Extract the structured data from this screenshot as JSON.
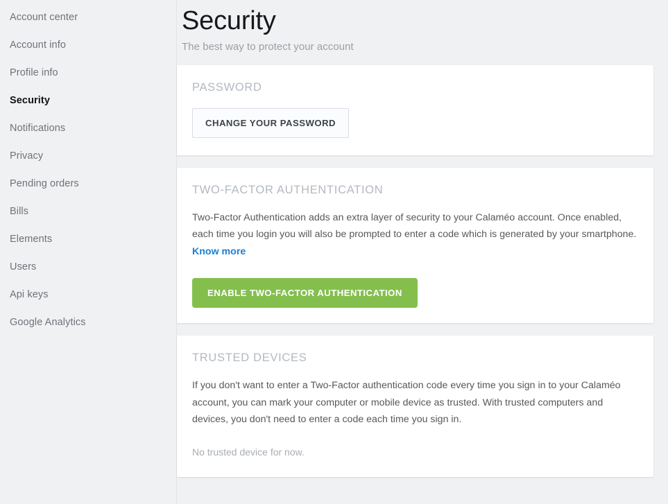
{
  "sidebar": {
    "items": [
      {
        "label": "Account center",
        "active": false
      },
      {
        "label": "Account info",
        "active": false
      },
      {
        "label": "Profile info",
        "active": false
      },
      {
        "label": "Security",
        "active": true
      },
      {
        "label": "Notifications",
        "active": false
      },
      {
        "label": "Privacy",
        "active": false
      },
      {
        "label": "Pending orders",
        "active": false
      },
      {
        "label": "Bills",
        "active": false
      },
      {
        "label": "Elements",
        "active": false
      },
      {
        "label": "Users",
        "active": false
      },
      {
        "label": "Api keys",
        "active": false
      },
      {
        "label": "Google Analytics",
        "active": false
      }
    ]
  },
  "header": {
    "title": "Security",
    "subtitle": "The best way to protect your account"
  },
  "cards": {
    "password": {
      "title": "PASSWORD",
      "button_label": "CHANGE YOUR PASSWORD"
    },
    "two_factor": {
      "title": "TWO-FACTOR AUTHENTICATION",
      "body": "Two-Factor Authentication adds an extra layer of security to your Calaméo account. Once enabled, each time you login you will also be prompted to enter a code which is generated by your smartphone.",
      "link_label": "Know more",
      "button_label": "ENABLE TWO-FACTOR AUTHENTICATION"
    },
    "trusted_devices": {
      "title": "TRUSTED DEVICES",
      "body": "If you don't want to enter a Two-Factor authentication code every time you sign in to your Calaméo account, you can mark your computer or mobile device as trusted. With trusted computers and devices, you don't need to enter a code each time you sign in.",
      "empty_state": "No trusted device for now."
    }
  },
  "colors": {
    "page_background": "#f0f1f3",
    "card_background": "#ffffff",
    "accent_green": "#84bf4e",
    "link_blue": "#1a7fd4",
    "card_title_gray": "#b3b9c0",
    "body_text": "#56585a",
    "sidebar_text": "#6e7378",
    "sidebar_active_text": "#111417"
  }
}
